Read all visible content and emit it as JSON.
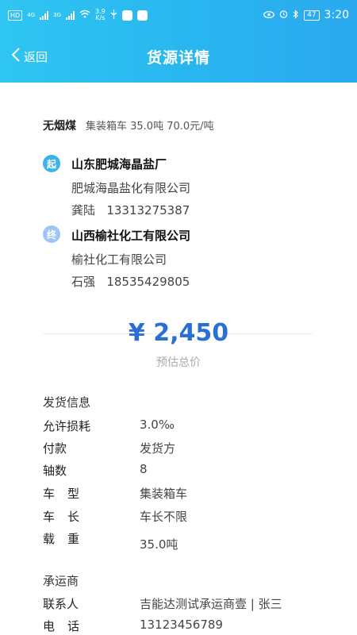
{
  "status_bar": {
    "hd_badge": "HD",
    "network_1": "4G",
    "network_2": "3G",
    "speed": "3.9",
    "speed_unit": "K/s",
    "battery": "47",
    "time": "3:20"
  },
  "nav": {
    "back_label": "返回",
    "title": "货源详情"
  },
  "cargo": {
    "name": "无烟煤",
    "desc": "集装箱车 35.0吨 70.0元/吨"
  },
  "origin": {
    "badge": "起",
    "badge_color": "#3bb4ea",
    "place": "山东肥城海晶盐厂",
    "company": "肥城海晶盐化有限公司",
    "contact_name": "龚陆",
    "contact_phone": "13313275387"
  },
  "destination": {
    "badge": "终",
    "badge_color": "#9cc6f5",
    "place": "山西榆社化工有限公司",
    "company": "榆社化工有限公司",
    "contact_name": "石强",
    "contact_phone": "18535429805"
  },
  "price": {
    "value": "¥ 2,450",
    "label": "预估总价",
    "color": "#2a6fd6"
  },
  "shipping": {
    "section_title": "发货信息",
    "rows": [
      {
        "label": "允许损耗",
        "value": "3.0‰"
      },
      {
        "label": "付款",
        "value": "发货方"
      },
      {
        "label": "轴数",
        "value": "8"
      },
      {
        "label": "车型",
        "value": "集装箱车"
      },
      {
        "label": "车长",
        "value": "车长不限"
      },
      {
        "label": "载重",
        "value": "35.0吨"
      }
    ]
  },
  "carrier": {
    "section_title": "承运商",
    "rows": [
      {
        "label": "联系人",
        "value": "吉能达测试承运商壹 | 张三"
      },
      {
        "label": "电话",
        "value": "13123456789"
      }
    ]
  }
}
